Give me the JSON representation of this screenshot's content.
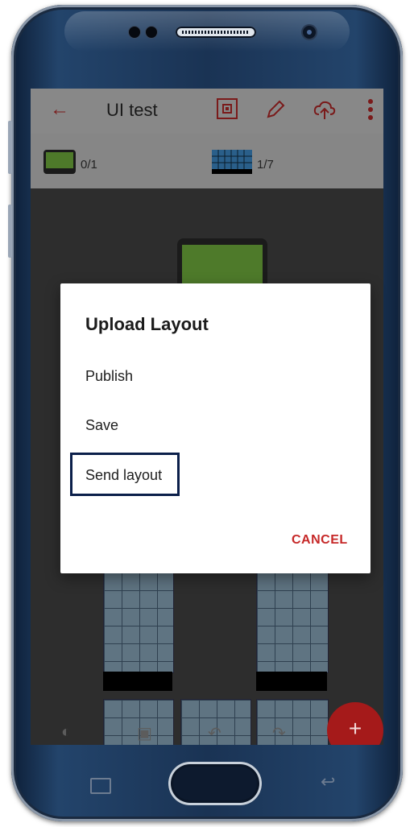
{
  "appbar": {
    "title": "UI test",
    "back_icon": "arrow-left-icon",
    "qr_icon": "qr-scan-icon",
    "edit_icon": "pencil-icon",
    "upload_icon": "cloud-upload-icon",
    "more_icon": "more-vert-icon"
  },
  "stats": {
    "screens_count": "0/1",
    "grids_count": "1/7"
  },
  "dialog": {
    "title": "Upload Layout",
    "items": [
      "Publish",
      "Save",
      "Send layout"
    ],
    "cancel_label": "CANCEL"
  },
  "fab": {
    "label": "+"
  },
  "colors": {
    "accent": "#c62828",
    "appbar_bg": "#888888",
    "highlight_border": "#0b1f4a"
  }
}
